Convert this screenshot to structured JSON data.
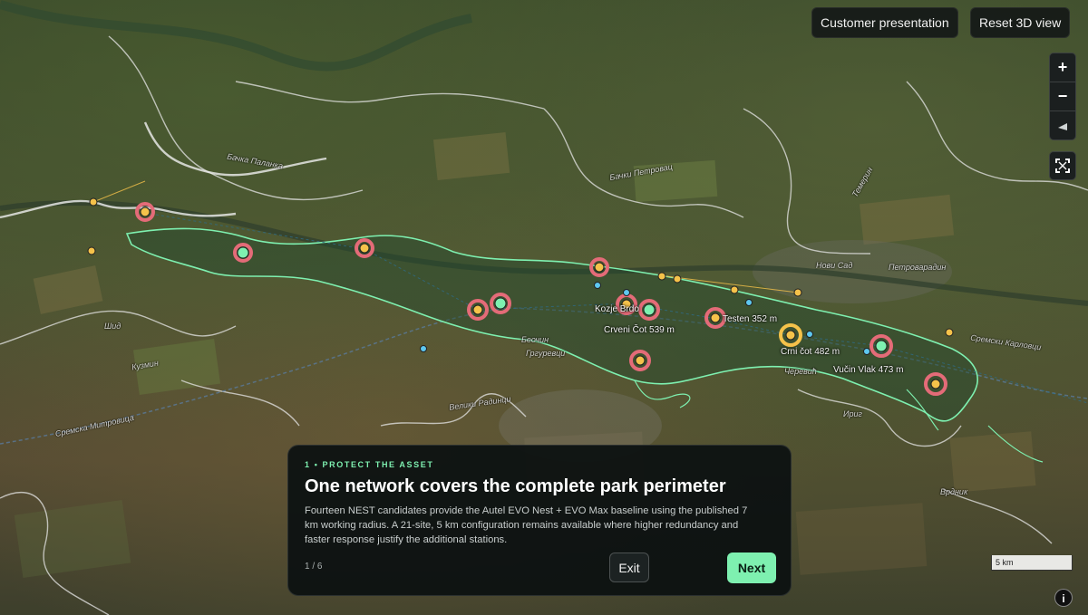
{
  "toolbar": {
    "customer_presentation_label": "Customer presentation",
    "reset_view_label": "Reset 3D view"
  },
  "map_controls": {
    "zoom_in_icon": "plus-icon",
    "zoom_out_icon": "minus-icon",
    "compass_icon": "compass-icon",
    "fullscreen_icon": "fullscreen-icon"
  },
  "point_labels": {
    "kozje": "Kozje Brdo",
    "crveni": "Crveni Čot 539 m",
    "testen": "Testen 352 m",
    "crni": "Crni čot 482 m",
    "vucin": "Vučin Vlak 473 m"
  },
  "place_labels": {
    "backa": "Бачка Паланка",
    "backi": "Бачки Петровац",
    "temerin": "Темерин",
    "novi_sad": "Нови Сад",
    "beocin": "Беочин",
    "irig": "Ириг",
    "sremski_karlovci": "Сремски Карловци",
    "veliki_radinci": "Велики Радинци",
    "mitrovica": "Сремска Митровица",
    "kuzmin": "Кузмин",
    "sid": "Шид",
    "grgurevci": "Гргуревци",
    "petrovaradin": "Петроварадин",
    "cerevic": "Черевић",
    "vrdnik": "Врдник"
  },
  "tour_panel": {
    "eyebrow": "1 • PROTECT THE ASSET",
    "title": "One network covers the complete park perimeter",
    "body": "Fourteen NEST candidates provide the Autel EVO Nest + EVO Max baseline using the published 7 km working radius. A 21-site, 5 km configuration remains available where higher redundancy and faster response justify the additional stations.",
    "pager": "1 / 6",
    "exit_label": "Exit",
    "next_label": "Next"
  },
  "scale_bar": {
    "label": "5 km"
  },
  "info_icon": "info-icon",
  "colors": {
    "accent": "#7ef0b0",
    "park_outline": "#7ef0b0",
    "candidate_ring": "#e46b78",
    "candidate_point": "#f5c24a",
    "active_point": "#7ef0b0",
    "auxiliary_point": "#5ec8f0",
    "panel_bg": "#0c1111"
  }
}
